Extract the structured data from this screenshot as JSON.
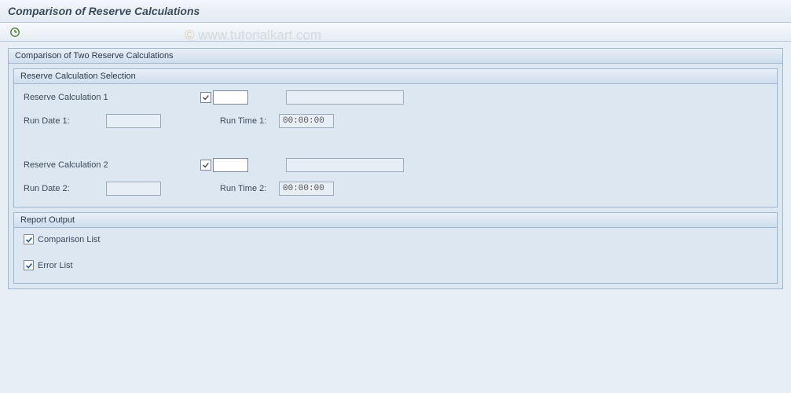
{
  "header": {
    "title": "Comparison of Reserve Calculations"
  },
  "toolbar": {
    "execute_icon": "execute-clock-icon"
  },
  "outer_group": {
    "title": "Comparison of Two Reserve Calculations"
  },
  "selection_group": {
    "title": "Reserve Calculation Selection",
    "calc1": {
      "label": "Reserve Calculation 1",
      "value": "",
      "desc": ""
    },
    "rundate1": {
      "label": "Run Date 1:",
      "value": ""
    },
    "runtime1": {
      "label": "Run Time 1:",
      "value": "00:00:00"
    },
    "calc2": {
      "label": "Reserve Calculation 2",
      "value": "",
      "desc": ""
    },
    "rundate2": {
      "label": "Run Date 2:",
      "value": ""
    },
    "runtime2": {
      "label": "Run Time 2:",
      "value": "00:00:00"
    }
  },
  "output_group": {
    "title": "Report Output",
    "comparison_list": {
      "label": "Comparison List",
      "checked": true
    },
    "error_list": {
      "label": "Error List",
      "checked": true
    }
  },
  "watermark": "www.tutorialkart.com"
}
